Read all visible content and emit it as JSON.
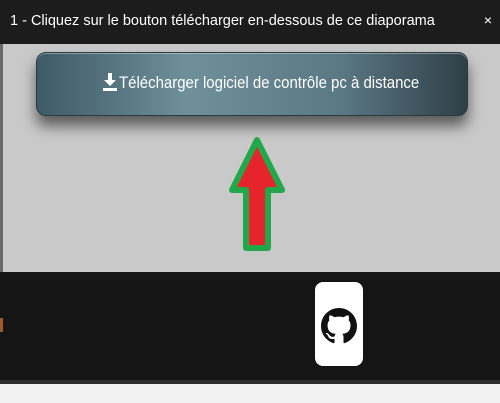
{
  "caption": {
    "text": "1 - Cliquez sur le bouton télécharger en-dessous de ce diaporama",
    "close_symbol": "×"
  },
  "slide": {
    "download_button_label": "Télécharger logiciel de contrôle pc à distance",
    "download_icon": "download-icon",
    "arrow_icon": "up-arrow-icon",
    "arrow_fill_color": "#e5242b",
    "arrow_border_color": "#22a84a"
  },
  "bottom": {
    "logo_icon": "github-icon"
  }
}
